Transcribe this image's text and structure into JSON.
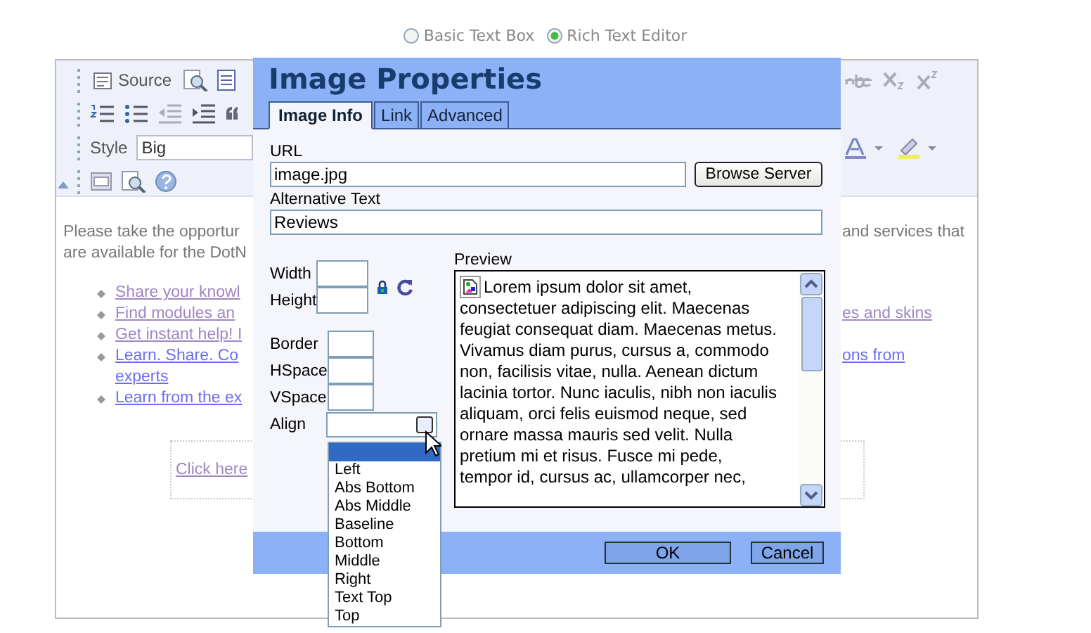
{
  "editor_mode": [
    {
      "label": "Basic Text Box",
      "selected": false
    },
    {
      "label": "Rich Text Editor",
      "selected": true
    }
  ],
  "toolbar": {
    "source_label": "Source",
    "style_label": "Style",
    "style_value": "Big"
  },
  "content": {
    "paragraph_left": [
      "Please take the opportur",
      "are available for the DotN"
    ],
    "paragraph_right": [
      "and services that"
    ],
    "links": [
      {
        "text": "Share your knowl",
        "visited": true
      },
      {
        "text": "Find modules an",
        "right": "es and skins ",
        "visited": true
      },
      {
        "text": "Get instant help! I",
        "visited": true
      },
      {
        "text": "Learn. Share. Co",
        "right": "ons from",
        "continuation": "experts ",
        "visited": false
      },
      {
        "text": "Learn from the ex",
        "visited": false
      }
    ],
    "click_here": {
      "text": "Click here",
      "visited": true
    }
  },
  "dialog": {
    "title": "Image Properties",
    "tabs": [
      {
        "label": "Image Info",
        "selected": true
      },
      {
        "label": "Link",
        "selected": false
      },
      {
        "label": "Advanced",
        "selected": false
      }
    ],
    "url": {
      "label": "URL",
      "value": "image.jpg"
    },
    "browse_button": "Browse Server",
    "alt_text": {
      "label": "Alternative Text",
      "value": "Reviews"
    },
    "size_fields": [
      "Width",
      "Height"
    ],
    "spacing_fields": [
      "Border",
      "HSpace",
      "VSpace"
    ],
    "align": {
      "label": "Align",
      "open": true,
      "blank_highlighted": true,
      "options": [
        "Left",
        "Abs Bottom",
        "Abs Middle",
        "Baseline",
        "Bottom",
        "Middle",
        "Right",
        "Text Top",
        "Top"
      ]
    },
    "preview": {
      "label": "Preview",
      "lines": [
        "Lorem ipsum dolor sit amet,",
        "consectetuer adipiscing elit. Maecenas",
        "feugiat consequat diam. Maecenas metus.",
        "Vivamus diam purus, cursus a, commodo",
        "non, facilisis vitae, nulla. Aenean dictum",
        "lacinia tortor. Nunc iaculis, nibh non iaculis",
        "aliquam, orci felis euismod neque, sed",
        "ornare massa mauris sed velit. Nulla",
        "pretium mi et risus. Fusce mi pede,",
        "tempor id, cursus ac, ullamcorper nec,"
      ]
    },
    "buttons": [
      "OK",
      "Cancel"
    ]
  }
}
